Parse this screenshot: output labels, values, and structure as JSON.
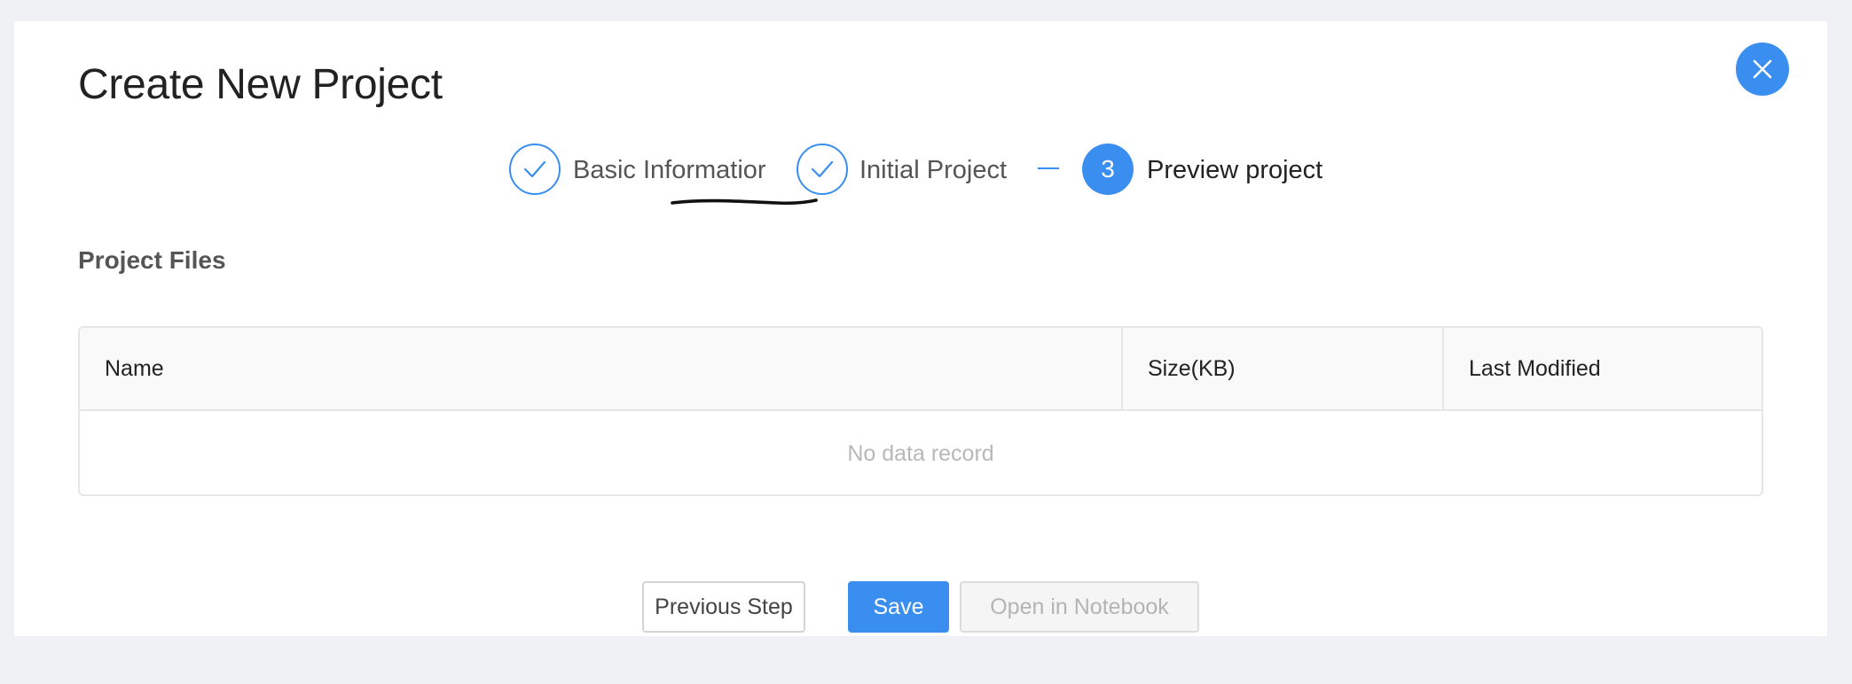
{
  "modal": {
    "title": "Create New Project",
    "close_icon": "close-icon"
  },
  "steps": [
    {
      "label": "Basic Informatior",
      "status": "done",
      "icon": "check-icon"
    },
    {
      "label": "Initial Project",
      "status": "done",
      "icon": "check-icon"
    },
    {
      "label": "Preview project",
      "status": "active",
      "number": "3"
    }
  ],
  "section": {
    "title": "Project Files"
  },
  "table": {
    "columns": [
      "Name",
      "Size(KB)",
      "Last Modified"
    ],
    "empty_text": "No data record"
  },
  "footer": {
    "previous_label": "Previous Step",
    "save_label": "Save",
    "notebook_label": "Open in Notebook"
  },
  "colors": {
    "accent": "#3a8ef0",
    "background": "#f0f1f4"
  }
}
